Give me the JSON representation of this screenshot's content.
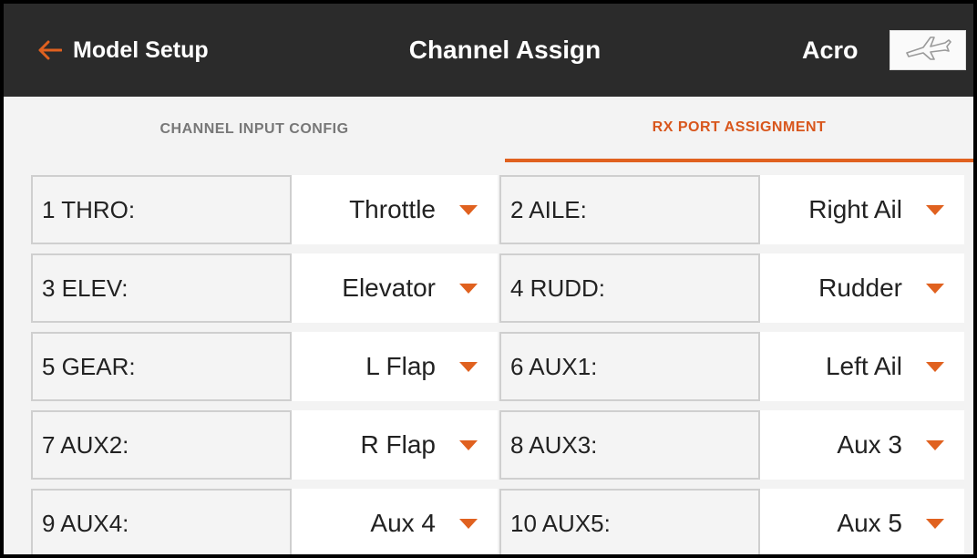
{
  "header": {
    "back_label": "Model Setup",
    "title": "Channel Assign",
    "mode": "Acro",
    "model_icon": "airplane-icon"
  },
  "tabs": [
    {
      "label": "CHANNEL INPUT CONFIG",
      "active": false
    },
    {
      "label": "RX PORT ASSIGNMENT",
      "active": true
    }
  ],
  "channels": [
    {
      "port": "1 THRO:",
      "value": "Throttle"
    },
    {
      "port": "2 AILE:",
      "value": "Right Ail"
    },
    {
      "port": "3 ELEV:",
      "value": "Elevator"
    },
    {
      "port": "4 RUDD:",
      "value": "Rudder"
    },
    {
      "port": "5 GEAR:",
      "value": "L Flap"
    },
    {
      "port": "6 AUX1:",
      "value": "Left Ail"
    },
    {
      "port": "7 AUX2:",
      "value": "R Flap"
    },
    {
      "port": "8 AUX3:",
      "value": "Aux 3"
    },
    {
      "port": "9 AUX4:",
      "value": "Aux 4"
    },
    {
      "port": "10 AUX5:",
      "value": "Aux 5"
    }
  ],
  "colors": {
    "accent": "#e0611f",
    "header_bg": "#2b2b2b"
  }
}
